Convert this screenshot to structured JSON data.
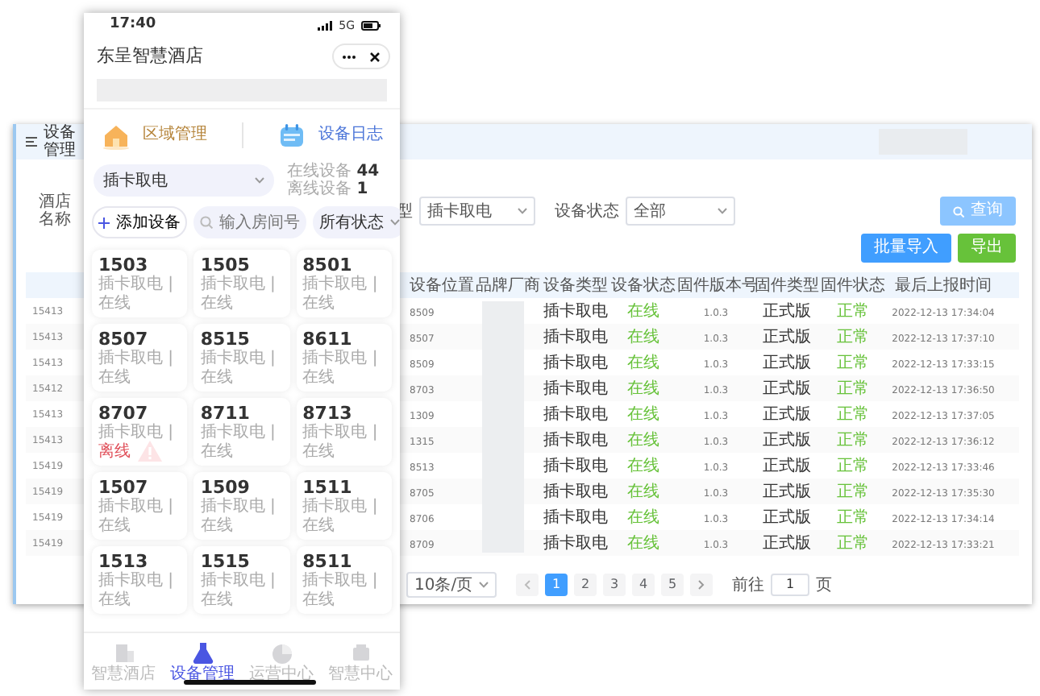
{
  "admin": {
    "breadcrumb": "设备管理",
    "hotel_label": "酒店名称",
    "type_label": "型",
    "type_value": "插卡取电",
    "status_label": "设备状态",
    "status_value": "全部",
    "buttons": [
      {
        "label": "查询",
        "kind": "search"
      },
      {
        "label": "批量导入",
        "kind": "import"
      },
      {
        "label": "导出",
        "kind": "export"
      }
    ],
    "table": {
      "columns": [
        "设备位置",
        "品牌厂商",
        "设备类型",
        "设备状态",
        "固件版本号",
        "固件类型",
        "固件状态",
        "最后上报时间"
      ],
      "rows": [
        {
          "column_1": "15413",
          "location": "8509",
          "type": "插卡取电",
          "status": "在线",
          "version": "1.0.3",
          "firmware_type": "正式版",
          "firmware_status": "正常",
          "reported": "2022-12-13 17:34:04"
        },
        {
          "column_1": "15413",
          "location": "8507",
          "type": "插卡取电",
          "status": "在线",
          "version": "1.0.3",
          "firmware_type": "正式版",
          "firmware_status": "正常",
          "reported": "2022-12-13 17:37:10"
        },
        {
          "column_1": "15413",
          "location": "8509",
          "type": "插卡取电",
          "status": "在线",
          "version": "1.0.3",
          "firmware_type": "正式版",
          "firmware_status": "正常",
          "reported": "2022-12-13 17:33:15"
        },
        {
          "column_1": "15412",
          "location": "8703",
          "type": "插卡取电",
          "status": "在线",
          "version": "1.0.3",
          "firmware_type": "正式版",
          "firmware_status": "正常",
          "reported": "2022-12-13 17:36:50"
        },
        {
          "column_1": "15413",
          "location": "1309",
          "type": "插卡取电",
          "status": "在线",
          "version": "1.0.3",
          "firmware_type": "正式版",
          "firmware_status": "正常",
          "reported": "2022-12-13 17:37:05"
        },
        {
          "column_1": "15413",
          "location": "1315",
          "type": "插卡取电",
          "status": "在线",
          "version": "1.0.3",
          "firmware_type": "正式版",
          "firmware_status": "正常",
          "reported": "2022-12-13 17:36:12"
        },
        {
          "column_1": "15419",
          "location": "8513",
          "type": "插卡取电",
          "status": "在线",
          "version": "1.0.3",
          "firmware_type": "正式版",
          "firmware_status": "正常",
          "reported": "2022-12-13 17:33:46"
        },
        {
          "column_1": "15419",
          "location": "8705",
          "type": "插卡取电",
          "status": "在线",
          "version": "1.0.3",
          "firmware_type": "正式版",
          "firmware_status": "正常",
          "reported": "2022-12-13 17:35:30"
        },
        {
          "column_1": "15419",
          "location": "8706",
          "type": "插卡取电",
          "status": "在线",
          "version": "1.0.3",
          "firmware_type": "正式版",
          "firmware_status": "正常",
          "reported": "2022-12-13 17:34:14"
        },
        {
          "column_1": "15419",
          "location": "8709",
          "type": "插卡取电",
          "status": "在线",
          "version": "1.0.3",
          "firmware_type": "正式版",
          "firmware_status": "正常",
          "reported": "2022-12-13 17:33:21"
        }
      ]
    },
    "pagination": {
      "page_size": "10条/页",
      "pages": [
        {
          "label": "1",
          "selected": true
        },
        {
          "label": "2",
          "selected": false
        },
        {
          "label": "3",
          "selected": false
        },
        {
          "label": "4",
          "selected": false
        },
        {
          "label": "5",
          "selected": false
        }
      ],
      "goto_label": "前往",
      "goto_value": "1",
      "page_unit": "页"
    }
  },
  "phone": {
    "time": "17:40",
    "network": "5G",
    "title": "东呈智慧酒店",
    "sections": [
      {
        "label": "区域管理",
        "kind": "area"
      },
      {
        "label": "设备日志",
        "kind": "log"
      }
    ],
    "device_type": "插卡取电",
    "stats": [
      {
        "label": "在线设备",
        "value": "44"
      },
      {
        "label": "离线设备",
        "value": "1"
      }
    ],
    "add_button": "添加设备",
    "search_placeholder": "输入房间号",
    "status_filter": "所有状态",
    "rooms": [
      {
        "number": "1503",
        "type": "插卡取电 |",
        "status": "在线",
        "online": true
      },
      {
        "number": "1505",
        "type": "插卡取电 |",
        "status": "在线",
        "online": true
      },
      {
        "number": "8501",
        "type": "插卡取电 |",
        "status": "在线",
        "online": true
      },
      {
        "number": "8507",
        "type": "插卡取电 |",
        "status": "在线",
        "online": true
      },
      {
        "number": "8515",
        "type": "插卡取电 |",
        "status": "在线",
        "online": true
      },
      {
        "number": "8611",
        "type": "插卡取电 |",
        "status": "在线",
        "online": true
      },
      {
        "number": "8707",
        "type": "插卡取电 |",
        "status": "离线",
        "online": false
      },
      {
        "number": "8711",
        "type": "插卡取电 |",
        "status": "在线",
        "online": true
      },
      {
        "number": "8713",
        "type": "插卡取电 |",
        "status": "在线",
        "online": true
      },
      {
        "number": "1507",
        "type": "插卡取电 |",
        "status": "在线",
        "online": true
      },
      {
        "number": "1509",
        "type": "插卡取电 |",
        "status": "在线",
        "online": true
      },
      {
        "number": "1511",
        "type": "插卡取电 |",
        "status": "在线",
        "online": true
      },
      {
        "number": "1513",
        "type": "插卡取电 |",
        "status": "在线",
        "online": true
      },
      {
        "number": "1515",
        "type": "插卡取电 |",
        "status": "在线",
        "online": true
      },
      {
        "number": "8511",
        "type": "插卡取电 |",
        "status": "在线",
        "online": true
      }
    ],
    "tabs": [
      {
        "label": "智慧酒店",
        "kind": "hotel",
        "selected": false
      },
      {
        "label": "设备管理",
        "kind": "device",
        "selected": true
      },
      {
        "label": "运营中心",
        "kind": "ops",
        "selected": false
      },
      {
        "label": "智慧中心",
        "kind": "smart",
        "selected": false
      }
    ]
  }
}
